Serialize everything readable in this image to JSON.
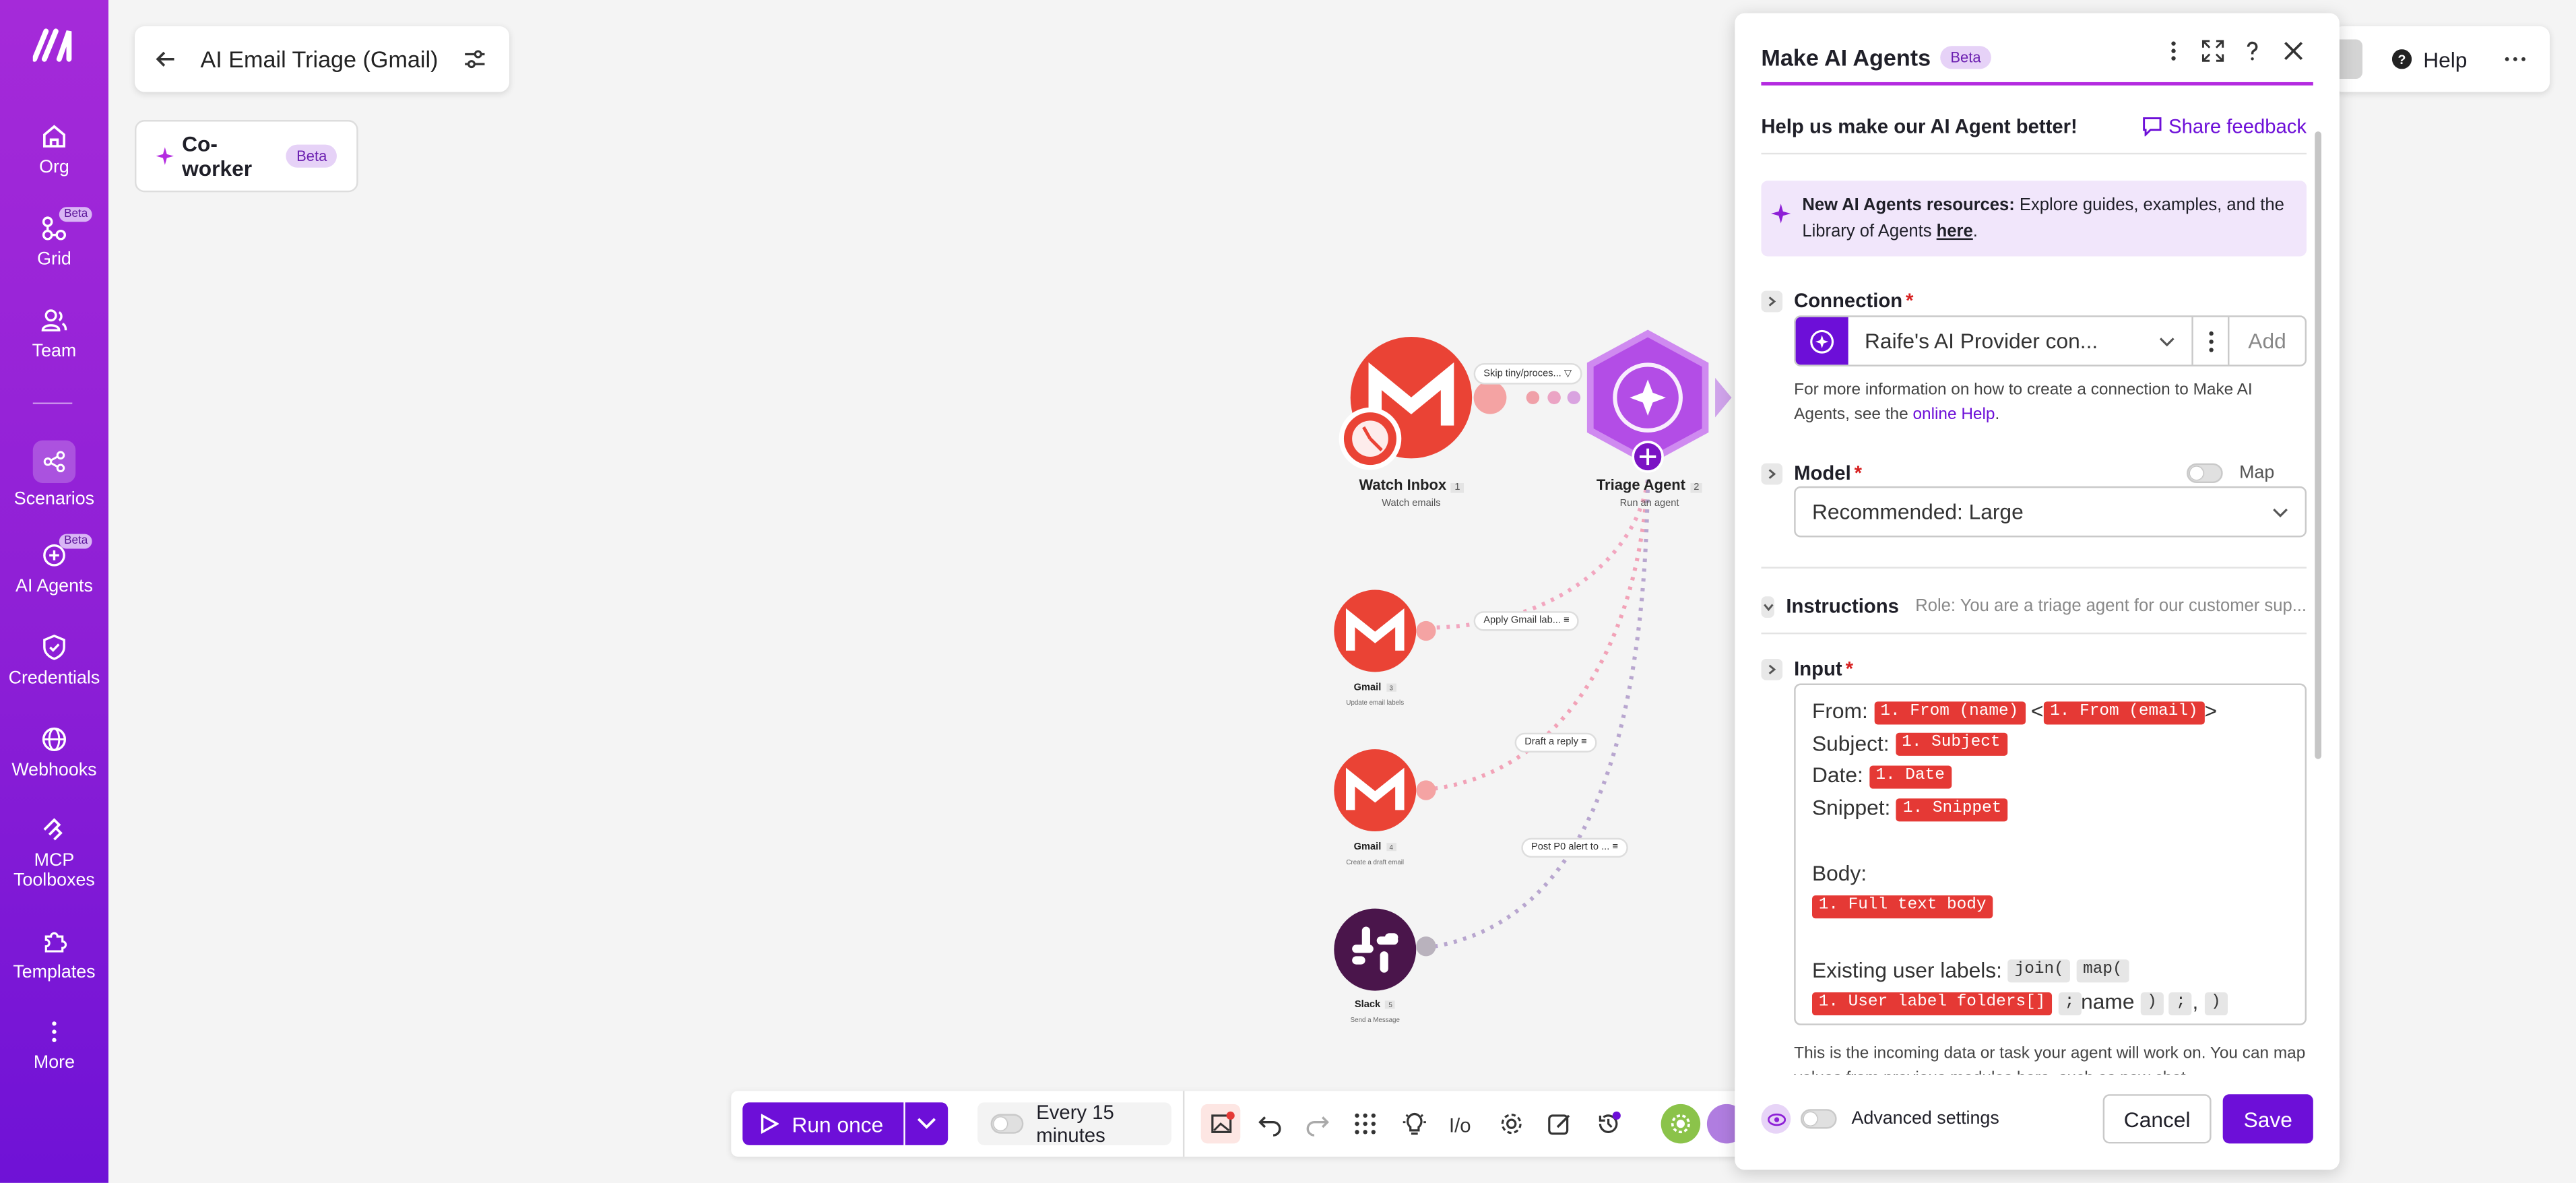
{
  "sidebar": {
    "items": [
      {
        "label": "Org",
        "icon": "home-icon"
      },
      {
        "label": "Grid",
        "icon": "grid-icon",
        "badge": "Beta"
      },
      {
        "label": "Team",
        "icon": "team-icon"
      },
      {
        "label": "Scenarios",
        "icon": "scenarios-icon",
        "active": true
      },
      {
        "label": "AI Agents",
        "icon": "ai-agents-icon",
        "badge": "Beta"
      },
      {
        "label": "Credentials",
        "icon": "shield-icon"
      },
      {
        "label": "Webhooks",
        "icon": "globe-icon"
      },
      {
        "label": "MCP",
        "label2": "Toolboxes",
        "icon": "mcp-icon"
      },
      {
        "label": "Templates",
        "icon": "puzzle-icon"
      },
      {
        "label": "More",
        "icon": "more-vertical-icon"
      }
    ]
  },
  "header": {
    "scenario_title": "AI Email Triage (Gmail)",
    "coworker_label": "Co-worker",
    "coworker_badge": "Beta",
    "help_label": "Help"
  },
  "canvas": {
    "nodes": [
      {
        "label": "Watch Inbox",
        "num": "1",
        "sub": "Watch emails"
      },
      {
        "label": "Triage Agent",
        "num": "2",
        "sub": "Run an agent"
      },
      {
        "label": "Gmail",
        "num": "3",
        "sub": "Update email labels"
      },
      {
        "label": "Gmail",
        "num": "4",
        "sub": "Create a draft email"
      },
      {
        "label": "Slack",
        "num": "5",
        "sub": "Send a Message"
      }
    ],
    "filters": [
      "Skip tiny/proces...",
      "Apply Gmail lab...",
      "Draft a reply",
      "Post P0 alert to ..."
    ],
    "colors": {
      "gmail": "#ea4335",
      "agent": "#9b30e0",
      "slack": "#4a154b"
    }
  },
  "toolbar": {
    "run_label": "Run once",
    "schedule_label": "Every 15 minutes"
  },
  "panel": {
    "title": "Make AI Agents",
    "badge": "Beta",
    "feedback_prompt": "Help us make our AI Agent better!",
    "feedback_link": "Share feedback",
    "info_bold": "New AI Agents resources:",
    "info_text": " Explore guides, examples, and the Library of Agents ",
    "info_link": "here",
    "info_end": ".",
    "connection_label": "Connection",
    "connection_value": "Raife's AI Provider con...",
    "connection_add": "Add",
    "connection_help": "For more information on how to create a connection to Make AI Agents, see the ",
    "connection_help_link": "online Help",
    "connection_help_end": ".",
    "model_label": "Model",
    "map_label": "Map",
    "model_value": "Recommended: Large",
    "instructions_label": "Instructions",
    "instructions_preview": "Role: You are a triage agent for our customer sup...",
    "input_label": "Input",
    "input": {
      "from_label": "From:",
      "from_name": "1. From (name)",
      "lt": "<",
      "from_email": "1. From (email)",
      "gt": ">",
      "subject_label": "Subject:",
      "subject": "1. Subject",
      "date_label": "Date:",
      "date": "1. Date",
      "snippet_label": "Snippet:",
      "snippet": "1. Snippet",
      "body_label": "Body:",
      "body": "1. Full text body",
      "labels_label": "Existing user labels:",
      "fn_join": "join(",
      "fn_map": "map(",
      "labels_tag": "1. User label folders[]",
      "semi": ";",
      "name": "name",
      "close": ")",
      "semi2": ";",
      "comma": ",",
      "close2": ")"
    },
    "input_help": "This is the incoming data or task your agent will work on. You can map values from previous modules here, such as new chat",
    "advanced_label": "Advanced settings",
    "cancel_label": "Cancel",
    "save_label": "Save",
    "accent": "#6d0fd8"
  }
}
